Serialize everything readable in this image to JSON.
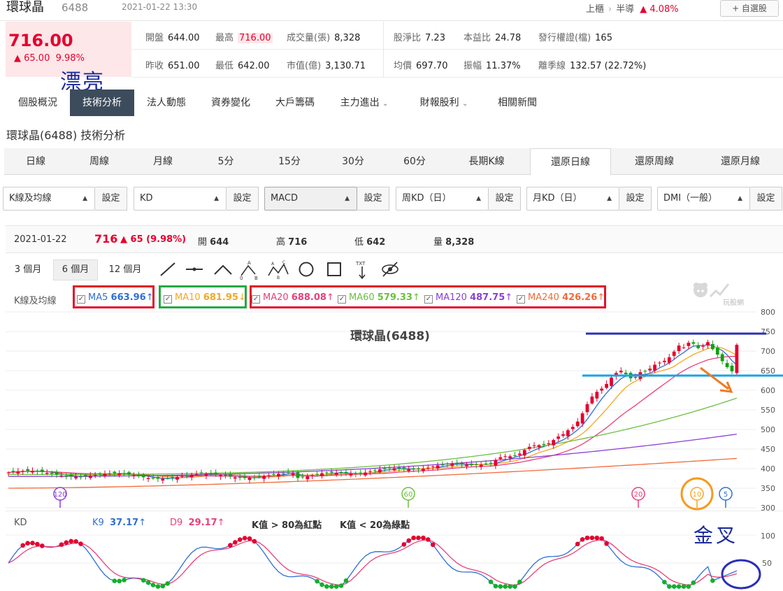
{
  "header": {
    "stock_name": "環球晶",
    "stock_code": "6488",
    "datetime": "2021-01-22 13:30",
    "market": "上櫃",
    "sector": "半導",
    "sector_change": "▲ 4.08%",
    "add_watch_label": "+ 自選股"
  },
  "quote": {
    "price": "716.00",
    "change": "▲ 65.00",
    "change_pct": "9.98%"
  },
  "annotations": {
    "pretty_note": "漂亮",
    "golden_cross_note": "金叉"
  },
  "stats": {
    "open_label": "開盤",
    "open": "644.00",
    "high_label": "最高",
    "high": "716.00",
    "volume_label": "成交量(張)",
    "volume": "8,328",
    "pb_label": "股淨比",
    "pb": "7.23",
    "pe_label": "本益比",
    "pe": "24.78",
    "warrants_label": "發行權證(檔)",
    "warrants": "165",
    "prev_label": "昨收",
    "prev": "651.00",
    "low_label": "最低",
    "low": "642.00",
    "mcap_label": "市值(億)",
    "mcap": "3,130.71",
    "avg_label": "均價",
    "avg": "697.70",
    "amp_label": "振幅",
    "amp": "11.37%",
    "season_label": "離季線",
    "season": "132.57 (22.72%)"
  },
  "nav": {
    "tabs": [
      {
        "label": "個股概況"
      },
      {
        "label": "技術分析"
      },
      {
        "label": "法人動態"
      },
      {
        "label": "資券變化"
      },
      {
        "label": "大戶籌碼"
      },
      {
        "label": "主力進出"
      },
      {
        "label": "財報股利"
      },
      {
        "label": "相關新聞"
      }
    ],
    "active": "技術分析"
  },
  "page_title": "環球晶(6488) 技術分析",
  "period_tabs": {
    "items": [
      {
        "label": "日線"
      },
      {
        "label": "周線"
      },
      {
        "label": "月線"
      },
      {
        "label": "5分"
      },
      {
        "label": "15分"
      },
      {
        "label": "30分"
      },
      {
        "label": "60分"
      },
      {
        "label": "長期K線"
      },
      {
        "label": "還原日線"
      },
      {
        "label": "還原周線"
      },
      {
        "label": "還原月線"
      }
    ],
    "active": "還原日線"
  },
  "selectors": [
    {
      "value": "K線及均線",
      "button": "設定"
    },
    {
      "value": "KD",
      "button": "設定"
    },
    {
      "value": "MACD",
      "button": "設定"
    },
    {
      "value": "周KD（日）",
      "button": "設定"
    },
    {
      "value": "月KD（日）",
      "button": "設定"
    },
    {
      "value": "DMI（一般）",
      "button": "設定"
    }
  ],
  "info_bar": {
    "date": "2021-01-22",
    "price": "716",
    "change": "▲ 65 (9.98%)",
    "open_label": "開",
    "open": "644",
    "high_label": "高",
    "high": "716",
    "low_label": "低",
    "low": "642",
    "vol_label": "量",
    "vol": "8,328"
  },
  "range_buttons": [
    {
      "label": "3 個月"
    },
    {
      "label": "6 個月"
    },
    {
      "label": "12 個月"
    }
  ],
  "range_active": "6 個月",
  "ma_legend": {
    "label": "K線及均線",
    "items": [
      {
        "name": "MA5",
        "value": "663.96",
        "arrow": "↑",
        "color": "#2f6fd6"
      },
      {
        "name": "MA10",
        "value": "681.95",
        "arrow": "↓",
        "color": "#f5a623"
      },
      {
        "name": "MA20",
        "value": "688.08",
        "arrow": "↑",
        "color": "#e8407a"
      },
      {
        "name": "MA60",
        "value": "579.33",
        "arrow": "↑",
        "color": "#6bbf3f"
      },
      {
        "name": "MA120",
        "value": "487.75",
        "arrow": "↑",
        "color": "#8a3fd8"
      },
      {
        "name": "MA240",
        "value": "426.26",
        "arrow": "↑",
        "color": "#f26b3a"
      }
    ]
  },
  "watermark": "玩股網",
  "chart_data": {
    "type": "candlestick",
    "title": "環球晶(6488)",
    "ylim": [
      300,
      800
    ],
    "y_ticks": [
      800,
      750,
      700,
      650,
      600,
      550,
      500,
      450,
      400,
      350,
      300
    ],
    "ma_markers": [
      "120",
      "60",
      "20",
      "10",
      "5"
    ],
    "last_candle": {
      "open": 644,
      "high": 716,
      "low": 642,
      "close": 716
    },
    "ma_last": {
      "MA5": 663.96,
      "MA10": 681.95,
      "MA20": 688.08,
      "MA60": 579.33,
      "MA120": 487.75,
      "MA240": 426.26
    }
  },
  "kd": {
    "label": "KD",
    "k_label": "K9",
    "k_value": "37.17",
    "k_arrow": "↑",
    "d_label": "D9",
    "d_value": "29.17",
    "d_arrow": "↑",
    "note_high": "K值 > 80為紅點",
    "note_low": "K值 < 20為綠點",
    "y_ticks": [
      "100",
      "50"
    ],
    "k_color": "#2f6fd6",
    "d_color": "#e8407a"
  }
}
